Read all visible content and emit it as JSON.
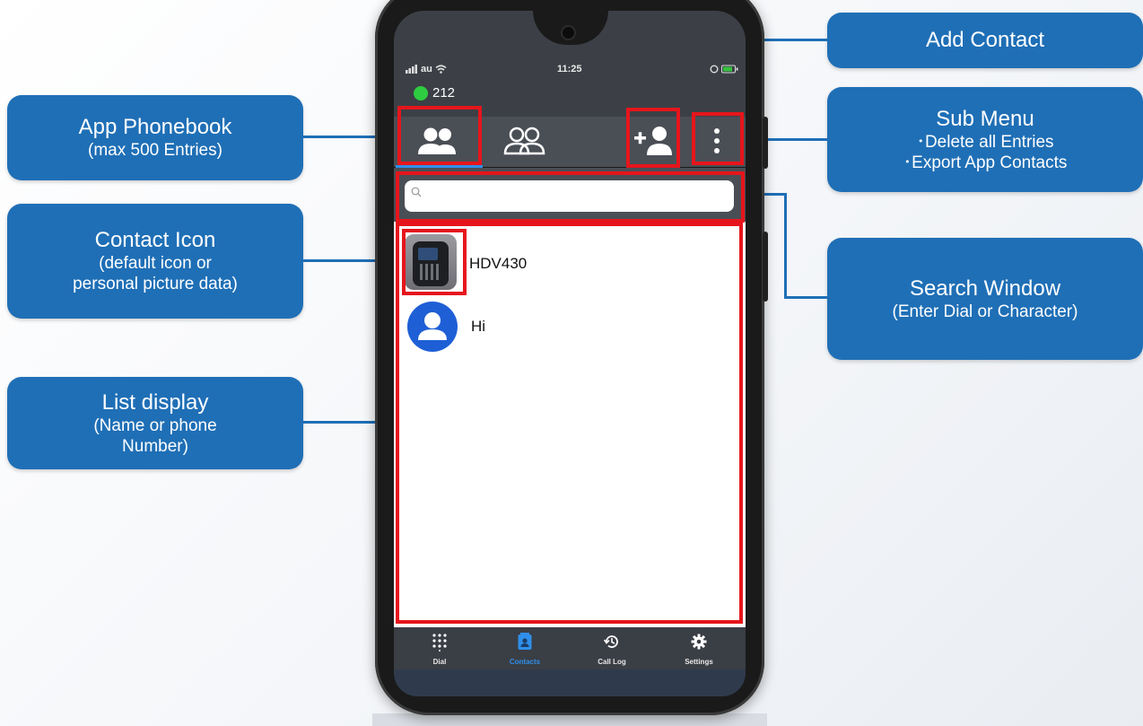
{
  "colors": {
    "callout": "#1f6fb6",
    "highlight": "#e6151c",
    "accent": "#2f8fea",
    "status_online": "#2ecc40"
  },
  "status_bar": {
    "carrier": "au",
    "time": "11:25"
  },
  "account": {
    "extension": "212"
  },
  "toolbar": {
    "app_phonebook_icon": "contacts-filled-icon",
    "shared_contacts_icon": "contacts-outline-icon",
    "add_contact_icon": "add-person-icon",
    "menu_icon": "vertical-dots-icon"
  },
  "search": {
    "placeholder": "",
    "icon": "search-icon"
  },
  "contacts": [
    {
      "name": "HDV430",
      "avatar": "phone-photo"
    },
    {
      "name": "Hi",
      "avatar": "default-person-icon"
    }
  ],
  "nav": [
    {
      "label": "Dial",
      "icon": "dialpad-icon",
      "active": false
    },
    {
      "label": "Contacts",
      "icon": "contact-card-icon",
      "active": true
    },
    {
      "label": "Call Log",
      "icon": "history-icon",
      "active": false
    },
    {
      "label": "Settings",
      "icon": "gear-icon",
      "active": false
    }
  ],
  "callouts": {
    "app_phonebook": {
      "title": "App Phonebook",
      "sub": "(max 500 Entries)"
    },
    "contact_icon": {
      "title": "Contact Icon",
      "sub1": "(default icon or",
      "sub2": "personal picture data)"
    },
    "list_display": {
      "title": "List display",
      "sub1": "(Name or phone",
      "sub2": "Number)"
    },
    "add_contact": {
      "title": "Add Contact"
    },
    "sub_menu": {
      "title": "Sub Menu",
      "item1": "･Delete all Entries",
      "item2": "･Export App Contacts"
    },
    "search_window": {
      "title": "Search Window",
      "sub": "(Enter Dial or Character)"
    }
  }
}
